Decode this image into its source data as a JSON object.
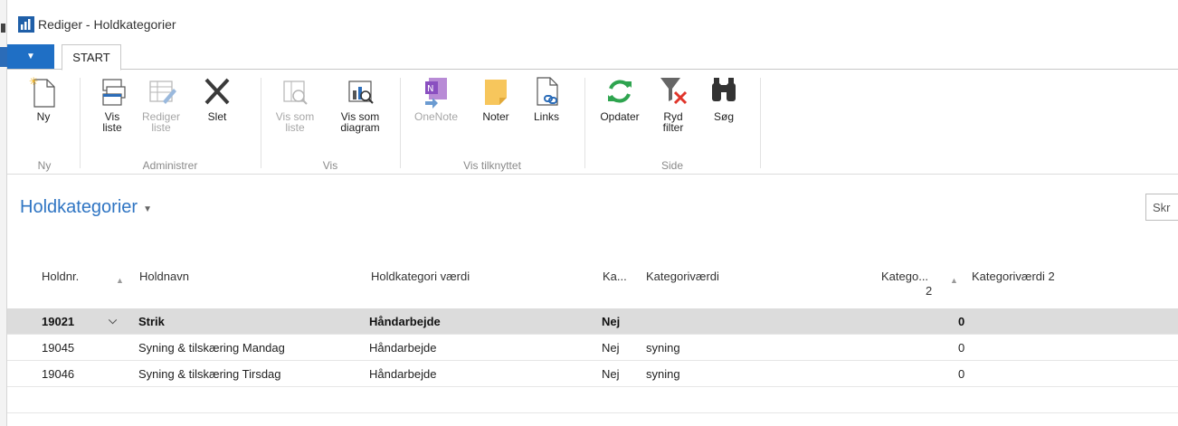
{
  "window": {
    "title": "Rediger - Holdkategorier"
  },
  "tabs": {
    "file_menu_icon": "caret-down-icon",
    "start_label": "START"
  },
  "ribbon": {
    "groups": {
      "ny": {
        "label": "Ny",
        "buttons": {
          "ny": "Ny"
        }
      },
      "administrer": {
        "label": "Administrer",
        "buttons": {
          "vis_liste": "Vis\nliste",
          "rediger_liste": "Rediger\nliste",
          "slet": "Slet"
        }
      },
      "vis": {
        "label": "Vis",
        "buttons": {
          "vis_som_liste": "Vis som\nliste",
          "vis_som_diagram": "Vis som\ndiagram"
        }
      },
      "vis_tilknyttet": {
        "label": "Vis tilknyttet",
        "buttons": {
          "onenote": "OneNote",
          "noter": "Noter",
          "links": "Links"
        }
      },
      "side": {
        "label": "Side",
        "buttons": {
          "opdater": "Opdater",
          "ryd_filter": "Ryd\nfilter",
          "sog": "Søg"
        }
      }
    }
  },
  "page": {
    "title": "Holdkategorier",
    "search_placeholder": "Skr"
  },
  "table": {
    "columns": [
      "Holdnr.",
      "Holdnavn",
      "Holdkategori værdi",
      "Ka...",
      "Kategoriværdi",
      "Katego...",
      "2",
      "Kategoriværdi 2"
    ],
    "rows": [
      {
        "holdnr": "19021",
        "holdnavn": "Strik",
        "holdkategori": "Håndarbejde",
        "ka": "Nej",
        "kategorivaerdi": "",
        "katego": "0",
        "kategorivaerdi2": ""
      },
      {
        "holdnr": "19045",
        "holdnavn": "Syning & tilskæring Mandag",
        "holdkategori": "Håndarbejde",
        "ka": "Nej",
        "kategorivaerdi": "syning",
        "katego": "0",
        "kategorivaerdi2": ""
      },
      {
        "holdnr": "19046",
        "holdnavn": "Syning & tilskæring Tirsdag",
        "holdkategori": "Håndarbejde",
        "ka": "Nej",
        "kategorivaerdi": "syning",
        "katego": "0",
        "kategorivaerdi2": ""
      }
    ]
  },
  "colors": {
    "accent": "#1f6fc5",
    "title_blue": "#2f75c3",
    "selected_row": "#dcdcdc",
    "refresh_green": "#2ea44f"
  }
}
